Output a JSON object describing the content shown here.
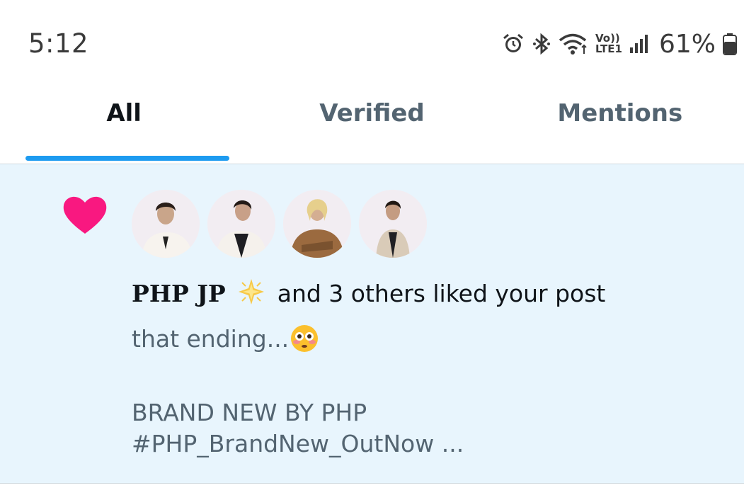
{
  "status_bar": {
    "time": "5:12",
    "icons": [
      "alarm-icon",
      "bluetooth-icon",
      "wifi-icon",
      "volte-icon",
      "signal-icon",
      "battery-icon"
    ],
    "volte_top": "Vo))",
    "volte_bottom": "LTE1",
    "battery_percent": "61%"
  },
  "tabs": [
    {
      "label": "All",
      "active": true
    },
    {
      "label": "Verified",
      "active": false
    },
    {
      "label": "Mentions",
      "active": false
    }
  ],
  "notification": {
    "icon": "heart-icon",
    "icon_color": "#f91880",
    "user_name": "PHP JP",
    "user_emoji": "sparkle-star-emoji",
    "action_text": "and 3 others liked your post",
    "post_line1": "that ending...",
    "post_line1_emoji": "flushed-face-emoji",
    "post_line2": "BRAND NEW BY PHP",
    "post_line3": "#PHP_BrandNew_OutNow ..."
  },
  "colors": {
    "accent": "#1d9bf0",
    "notification_bg": "#e8f5fd",
    "secondary_text": "#536471"
  }
}
